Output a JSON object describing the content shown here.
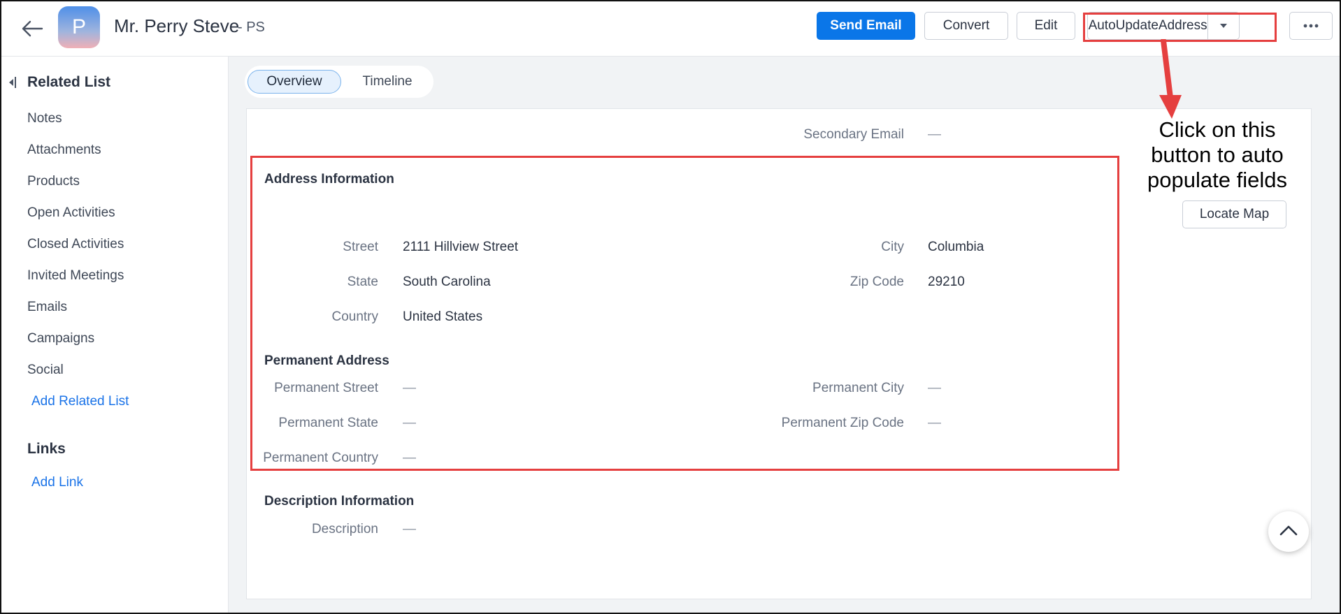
{
  "header": {
    "back_icon": "arrow-left-icon",
    "avatar_initial": "P",
    "name": "Mr. Perry Steve",
    "short_name": "- PS",
    "buttons": {
      "send_email": "Send Email",
      "convert": "Convert",
      "edit": "Edit",
      "auto_update": "AutoUpdateAddress",
      "more_icon": "more-horizontal-icon"
    }
  },
  "sidebar": {
    "related_title": "Related List",
    "items": [
      "Notes",
      "Attachments",
      "Products",
      "Open Activities",
      "Closed Activities",
      "Invited Meetings",
      "Emails",
      "Campaigns",
      "Social"
    ],
    "add_related": "Add Related List",
    "links_title": "Links",
    "add_link": "Add Link"
  },
  "tabs": [
    "Overview",
    "Timeline"
  ],
  "details": {
    "secondary_email": {
      "label": "Secondary Email",
      "value": "—"
    },
    "address_section": "Address Information",
    "street": {
      "label": "Street",
      "value": "2111 Hillview Street"
    },
    "city": {
      "label": "City",
      "value": "Columbia"
    },
    "state": {
      "label": "State",
      "value": "South Carolina"
    },
    "zip": {
      "label": "Zip Code",
      "value": "29210"
    },
    "country": {
      "label": "Country",
      "value": "United States"
    },
    "permanent_section": "Permanent Address",
    "perm_street": {
      "label": "Permanent Street",
      "value": "—"
    },
    "perm_city": {
      "label": "Permanent City",
      "value": "—"
    },
    "perm_state": {
      "label": "Permanent State",
      "value": "—"
    },
    "perm_zip": {
      "label": "Permanent Zip Code",
      "value": "—"
    },
    "perm_country": {
      "label": "Permanent Country",
      "value": "—"
    },
    "description_section": "Description Information",
    "description": {
      "label": "Description",
      "value": "—"
    },
    "locate_map": "Locate Map"
  },
  "annotation": {
    "text_line1": "Click on this",
    "text_line2": "button to auto",
    "text_line3": "populate fields",
    "color": "#e53f3f"
  },
  "colors": {
    "primary": "#0a76e8",
    "link": "#1a73e8",
    "highlight": "#e53f3f"
  }
}
